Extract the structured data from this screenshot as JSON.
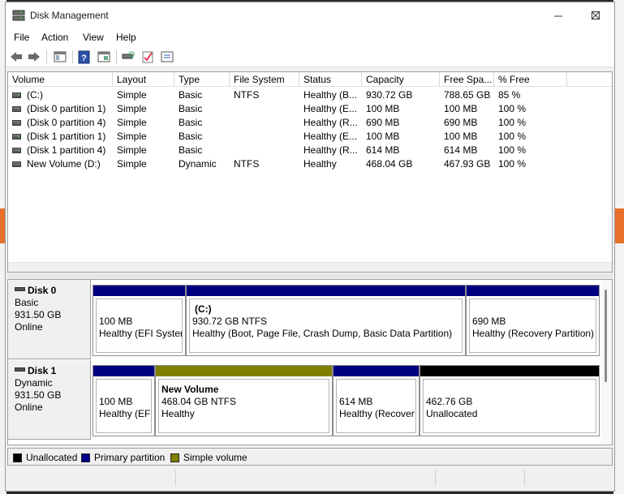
{
  "window": {
    "title": "Disk Management"
  },
  "menu": [
    "File",
    "Action",
    "View",
    "Help"
  ],
  "volume_table": {
    "columns": [
      "Volume",
      "Layout",
      "Type",
      "File System",
      "Status",
      "Capacity",
      "Free Spa...",
      "% Free"
    ],
    "rows": [
      [
        "(C:)",
        "Simple",
        "Basic",
        "NTFS",
        "Healthy (B...",
        "930.72 GB",
        "788.65 GB",
        "85 %"
      ],
      [
        "(Disk 0 partition 1)",
        "Simple",
        "Basic",
        "",
        "Healthy (E...",
        "100 MB",
        "100 MB",
        "100 %"
      ],
      [
        "(Disk 0 partition 4)",
        "Simple",
        "Basic",
        "",
        "Healthy (R...",
        "690 MB",
        "690 MB",
        "100 %"
      ],
      [
        "(Disk 1 partition 1)",
        "Simple",
        "Basic",
        "",
        "Healthy (E...",
        "100 MB",
        "100 MB",
        "100 %"
      ],
      [
        "(Disk 1 partition 4)",
        "Simple",
        "Basic",
        "",
        "Healthy (R...",
        "614 MB",
        "614 MB",
        "100 %"
      ],
      [
        "New Volume (D:)",
        "Simple",
        "Dynamic",
        "NTFS",
        "Healthy",
        "468.04 GB",
        "467.93 GB",
        "100 %"
      ]
    ]
  },
  "disks": [
    {
      "name": "Disk 0",
      "type": "Basic",
      "size": "931.50 GB",
      "status": "Online",
      "partitions": [
        {
          "title": "",
          "line1": "100 MB",
          "line2": "Healthy (EFI System",
          "kind": "primary"
        },
        {
          "title": "(C:)",
          "line1": "930.72 GB NTFS",
          "line2": "Healthy (Boot, Page File, Crash Dump, Basic Data Partition)",
          "kind": "primary"
        },
        {
          "title": "",
          "line1": "690 MB",
          "line2": "Healthy (Recovery Partition)",
          "kind": "primary"
        }
      ]
    },
    {
      "name": "Disk 1",
      "type": "Dynamic",
      "size": "931.50 GB",
      "status": "Online",
      "partitions": [
        {
          "title": "",
          "line1": "100 MB",
          "line2": "Healthy (EF",
          "kind": "primary"
        },
        {
          "title": "New Volume",
          "line1": "468.04 GB NTFS",
          "line2": "Healthy",
          "kind": "simple"
        },
        {
          "title": "",
          "line1": "614 MB",
          "line2": "Healthy (Recover",
          "kind": "primary"
        },
        {
          "title": "",
          "line1": "462.76 GB",
          "line2": "Unallocated",
          "kind": "unallocated"
        }
      ]
    }
  ],
  "legend": [
    {
      "label": "Unallocated",
      "color": "#000000"
    },
    {
      "label": "Primary partition",
      "color": "#00008b"
    },
    {
      "label": "Simple volume",
      "color": "#808000"
    }
  ],
  "colors": {
    "primary": "#000080",
    "simple": "#808000",
    "unallocated": "#000000"
  },
  "toolbar_icons": [
    "back-arrow-icon",
    "forward-arrow-icon",
    "show-hide-console-tree-icon",
    "help-icon",
    "properties-icon",
    "rescan-disks-icon",
    "check-icon",
    "settings-list-icon"
  ]
}
